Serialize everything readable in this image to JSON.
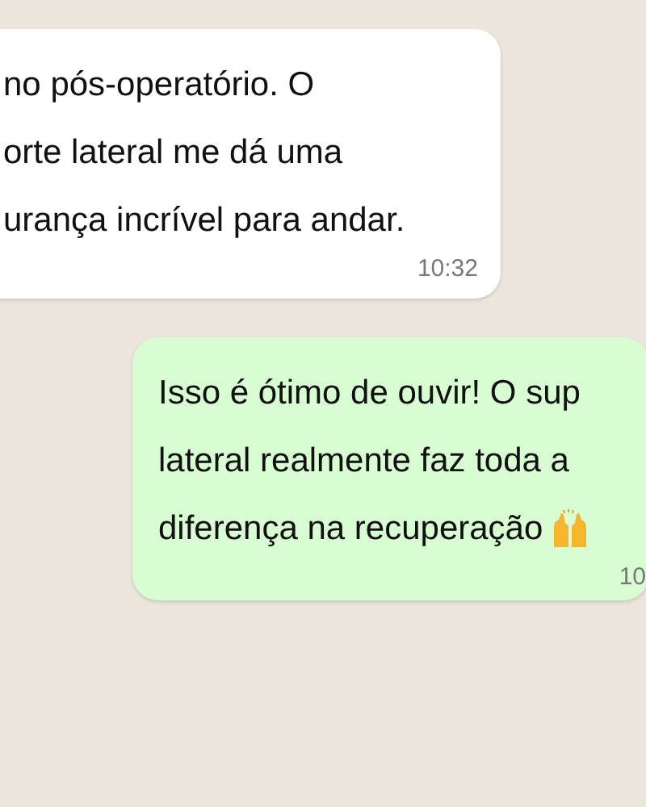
{
  "messages": [
    {
      "kind": "incoming",
      "lines": [
        "no pós-operatório. O",
        "orte lateral me dá uma",
        "urança incrível para andar."
      ],
      "time": "10:32"
    },
    {
      "kind": "outgoing",
      "lines": [
        "Isso é ótimo de ouvir! O sup",
        "lateral realmente faz toda a",
        "diferença na recuperação"
      ],
      "trailing_emoji": true,
      "time": "10"
    }
  ]
}
